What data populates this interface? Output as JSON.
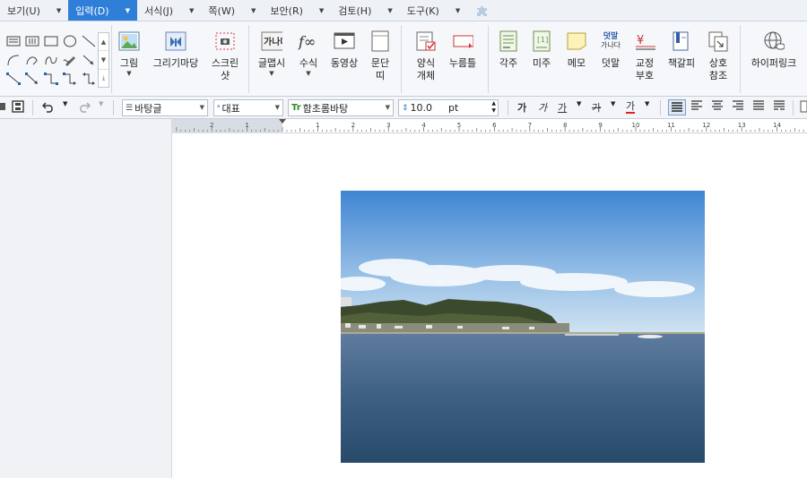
{
  "menubar": {
    "items": [
      {
        "label": "보기(U)",
        "active": false
      },
      {
        "label": "입력(D)",
        "active": true
      },
      {
        "label": "서식(J)",
        "active": false
      },
      {
        "label": "쪽(W)",
        "active": false
      },
      {
        "label": "보안(R)",
        "active": false
      },
      {
        "label": "검토(H)",
        "active": false
      },
      {
        "label": "도구(K)",
        "active": false
      }
    ],
    "extra_icon": "puzzle-icon",
    "active_color": "#2f7fd8"
  },
  "ribbon": {
    "buttons": [
      {
        "label": "그림",
        "icon": "picture-icon",
        "dropdown": true
      },
      {
        "label": "그리기마당",
        "icon": "drawing-gallery-icon",
        "dropdown": false
      },
      {
        "label": "스크린",
        "label2": "샷",
        "icon": "screenshot-icon",
        "dropdown": false
      },
      {
        "label": "글맵시",
        "icon": "text-art-icon",
        "dropdown": true
      },
      {
        "label": "수식",
        "icon": "equation-icon",
        "dropdown": true
      },
      {
        "label": "동영상",
        "icon": "video-icon",
        "dropdown": false
      },
      {
        "label": "문단",
        "label2": "띠",
        "icon": "paragraph-band-icon",
        "dropdown": false
      },
      {
        "label": "양식",
        "label2": "개체",
        "icon": "form-object-icon",
        "dropdown": true
      },
      {
        "label": "누름틀",
        "icon": "click-field-icon",
        "dropdown": false
      },
      {
        "label": "각주",
        "icon": "footnote-icon",
        "dropdown": false
      },
      {
        "label": "미주",
        "icon": "endnote-icon",
        "dropdown": false
      },
      {
        "label": "메모",
        "icon": "memo-icon",
        "dropdown": false
      },
      {
        "label": "덧말",
        "icon": "ruby-text-icon",
        "dropdown": false,
        "icon_text1": "덧말",
        "icon_text2": "가나다"
      },
      {
        "label": "교정",
        "label2": "부호",
        "icon": "proofreading-mark-icon",
        "dropdown": true
      },
      {
        "label": "책갈피",
        "icon": "bookmark-icon",
        "dropdown": false
      },
      {
        "label": "상호",
        "label2": "참조",
        "icon": "cross-reference-icon",
        "dropdown": false
      },
      {
        "label": "하이퍼링크",
        "icon": "hyperlink-icon",
        "dropdown": false
      }
    ],
    "shape_icons": [
      "text-box-icon",
      "vertical-text-box-icon",
      "rectangle-icon",
      "ellipse-icon",
      "line-icon",
      "arc-icon",
      "curve-icon",
      "freeform-icon",
      "pen-icon",
      "arrow-line-icon",
      "connector-straight-icon",
      "connector-arrow-icon",
      "connector-elbow-icon",
      "connector-elbow-arrow-icon",
      "connector-elbow-double-icon"
    ]
  },
  "toolbar": {
    "style_combo": "바탕글",
    "lang_combo": "대표",
    "font_combo": "함초롬바탕",
    "size_value": "10.0",
    "size_unit": "pt",
    "fmt": [
      "가",
      "가",
      "가",
      "가",
      "가"
    ]
  },
  "ruler": {
    "numbers": [
      "2",
      "1",
      "1",
      "2",
      "3",
      "4",
      "5",
      "6",
      "7",
      "8",
      "9",
      "10",
      "11",
      "12",
      "13",
      "14"
    ]
  },
  "document": {
    "photo": {
      "icon": "seaside-landscape-photo"
    }
  }
}
